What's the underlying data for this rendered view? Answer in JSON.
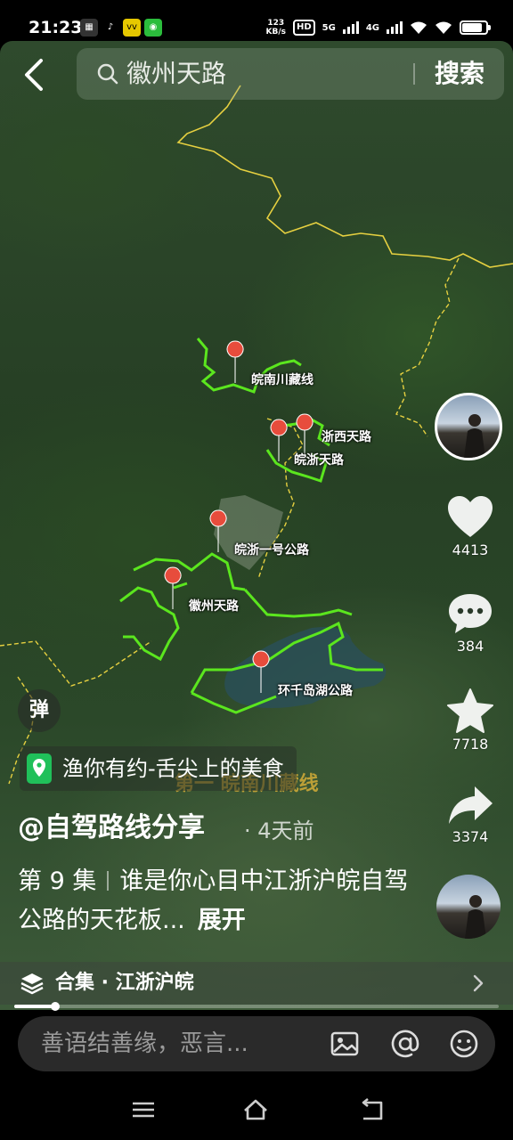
{
  "status_bar": {
    "time": "21:23",
    "net_speed_value": "123",
    "net_speed_unit": "KB/s",
    "hd_badge": "HD",
    "signal_1": "5G",
    "signal_2": "4G"
  },
  "search": {
    "query": "徽州天路",
    "button_label": "搜索"
  },
  "map_labels": [
    "皖南川藏线",
    "浙西天路",
    "皖浙天路",
    "皖浙一号公路",
    "徽州天路",
    "环千岛湖公路"
  ],
  "rail": {
    "like_count": "4413",
    "comment_count": "384",
    "favorite_count": "7718",
    "share_count": "3374"
  },
  "danmaku_label": "弹",
  "location_tag": "渔你有约-舌尖上的美食",
  "burned_caption": "第一 皖南川藏线",
  "author": "@自驾路线分享",
  "post_time": "· 4天前",
  "description": {
    "episode": "第 9 集",
    "text": "谁是你心目中江浙沪皖自驾公路的天花板...",
    "expand": "展开"
  },
  "collection": {
    "label": "合集 · 江浙沪皖"
  },
  "playback": {
    "progress": 0.085
  },
  "comment_input": {
    "placeholder": "善语结善缘，恶言..."
  },
  "icons": {
    "back": "back-arrow-icon",
    "search": "search-icon",
    "like": "heart-icon",
    "comment": "comment-bubble-icon",
    "favorite": "star-icon",
    "share": "share-arrow-icon",
    "location": "location-pin-icon",
    "collection": "layers-icon",
    "image": "image-icon",
    "mention": "at-icon",
    "emoji": "emoji-icon"
  },
  "colors": {
    "route": "#5be61e",
    "border": "#e6d040",
    "pin": "#e74c3c",
    "location_icon": "#20c05a"
  }
}
